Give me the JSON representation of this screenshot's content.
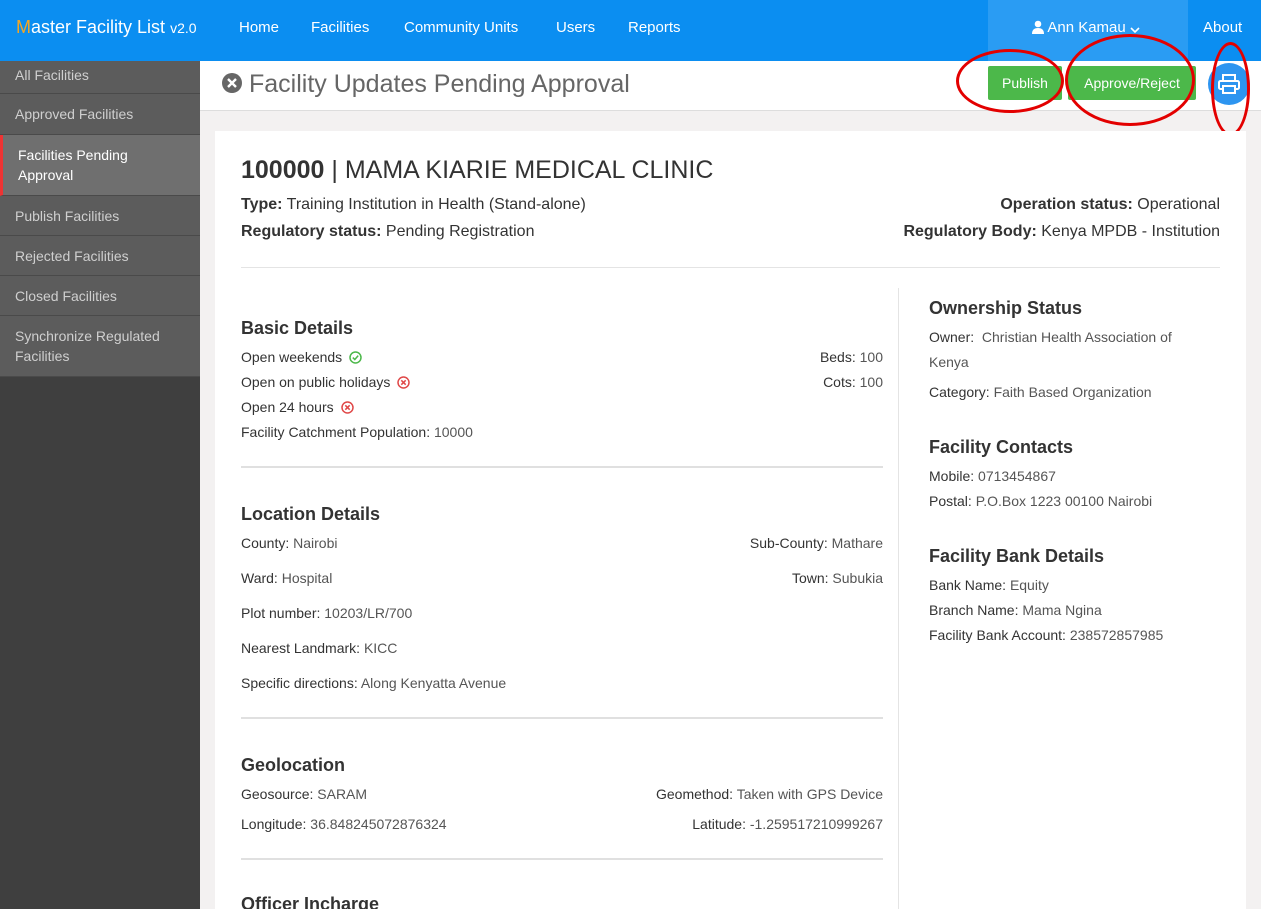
{
  "nav": {
    "brand_first": "M",
    "brand_rest": "aster Facility List",
    "brand_version": "v2.0",
    "links": [
      "Home",
      "Facilities",
      "Community Units",
      "Users",
      "Reports"
    ],
    "user": "Ann Kamau",
    "about": "About"
  },
  "sidebar": {
    "items": [
      "All Facilities",
      "Approved Facilities",
      "Facilities Pending Approval",
      "Publish Facilities",
      "Rejected Facilities",
      "Closed Facilities",
      "Synchronize Regulated Facilities"
    ],
    "active_index": 2
  },
  "header": {
    "title": "Facility Updates Pending Approval",
    "publish_label": "Publish",
    "approve_label": "Approve/Reject",
    "print_icon": "print-icon"
  },
  "facility": {
    "code": "100000",
    "separator": "|",
    "name": "MAMA KIARIE MEDICAL CLINIC",
    "type_label": "Type:",
    "type_value": "Training Institution in Health (Stand-alone)",
    "reg_status_label": "Regulatory status:",
    "reg_status_value": "Pending Registration",
    "op_status_label": "Operation status:",
    "op_status_value": "Operational",
    "reg_body_label": "Regulatory Body:",
    "reg_body_value": "Kenya MPDB - Institution"
  },
  "basic": {
    "heading": "Basic Details",
    "open_weekends": "Open weekends",
    "open_holidays": "Open on public holidays",
    "open_24": "Open 24 hours",
    "catchment_label": "Facility Catchment Population:",
    "catchment_value": "10000",
    "beds_label": "Beds:",
    "beds_value": "100",
    "cots_label": "Cots:",
    "cots_value": "100",
    "yes_color": "#4cb84a",
    "no_color": "#e04848"
  },
  "location": {
    "heading": "Location Details",
    "county_label": "County:",
    "county_value": "Nairobi",
    "subcounty_label": "Sub-County:",
    "subcounty_value": "Mathare",
    "ward_label": "Ward:",
    "ward_value": "Hospital",
    "town_label": "Town:",
    "town_value": "Subukia",
    "plot_label": "Plot number:",
    "plot_value": "10203/LR/700",
    "landmark_label": "Nearest Landmark:",
    "landmark_value": "KICC",
    "directions_label": "Specific directions:",
    "directions_value": "Along Kenyatta Avenue"
  },
  "geo": {
    "heading": "Geolocation",
    "source_label": "Geosource:",
    "source_value": "SARAM",
    "method_label": "Geomethod:",
    "method_value": "Taken with GPS Device",
    "lon_label": "Longitude:",
    "lon_value": "36.848245072876324",
    "lat_label": "Latitude:",
    "lat_value": "-1.259517210999267"
  },
  "officer": {
    "heading": "Officer Incharge"
  },
  "ownership": {
    "heading": "Ownership Status",
    "owner_label": "Owner:",
    "owner_value_1": "Christian Health Association of",
    "owner_value_2": "Kenya",
    "category_label": "Category:",
    "category_value": "Faith Based Organization"
  },
  "contacts": {
    "heading": "Facility Contacts",
    "mobile_label": "Mobile:",
    "mobile_value": "0713454867",
    "postal_label": "Postal:",
    "postal_value": "P.O.Box 1223 00100 Nairobi"
  },
  "bank": {
    "heading": "Facility Bank Details",
    "name_label": "Bank Name:",
    "name_value": "Equity",
    "branch_label": "Branch Name:",
    "branch_value": "Mama Ngina",
    "account_label": "Facility Bank Account:",
    "account_value": "238572857985"
  },
  "colors": {
    "navbar": "#0b8ef1",
    "button_green": "#4cb84a",
    "annotation_red": "#e30000"
  }
}
